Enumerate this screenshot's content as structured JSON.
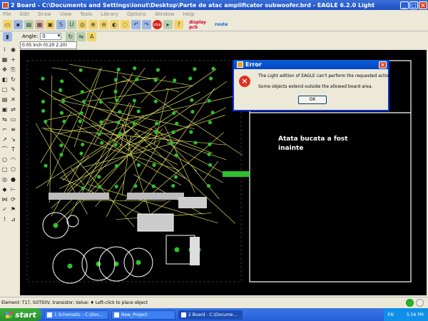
{
  "window": {
    "title": "2 Board - C:\\Documents and Settings\\ionut\\Desktop\\Parte de atac amplificator subwoofer.brd - EAGLE 6.2.0 Light",
    "btn_min": "_",
    "btn_max": "□",
    "btn_close": "×"
  },
  "menu": [
    "File",
    "Edit",
    "Draw",
    "View",
    "Tools",
    "Library",
    "Options",
    "Window",
    "Help"
  ],
  "toolbar": {
    "brand1": "display",
    "brand2": "pcb",
    "brand3": "route",
    "brand4": "stop"
  },
  "toolbar2": {
    "angle_label": "Angle:",
    "angle_value": "0"
  },
  "grid_readout": "0.05 inch (0.20 2.20)",
  "canvas": {
    "note_line1": "Atata bucata a fost",
    "note_line2": "inainte"
  },
  "dialog": {
    "title": "Error",
    "icon": "error-icon",
    "message1": "The Light edition of EAGLE can't perform the requested action!",
    "message2": "Some objects extend outside the allowed board area.",
    "ok": "OK"
  },
  "status": {
    "text": "Element: T17, SOT93V, transistor, Value:    ♦ Left-click to place object"
  },
  "taskbar": {
    "start": "start",
    "tasks": [
      "1 Schematic - C:\\Doc...",
      "New_Project",
      "2 Board - C:\\Docume..."
    ],
    "lang": "EN",
    "clock": "5:56 PM"
  },
  "colors": {
    "board_bg": "#000000",
    "trace": "#d8d860",
    "pad": "#2fbf2f",
    "outline": "#ffffff"
  }
}
